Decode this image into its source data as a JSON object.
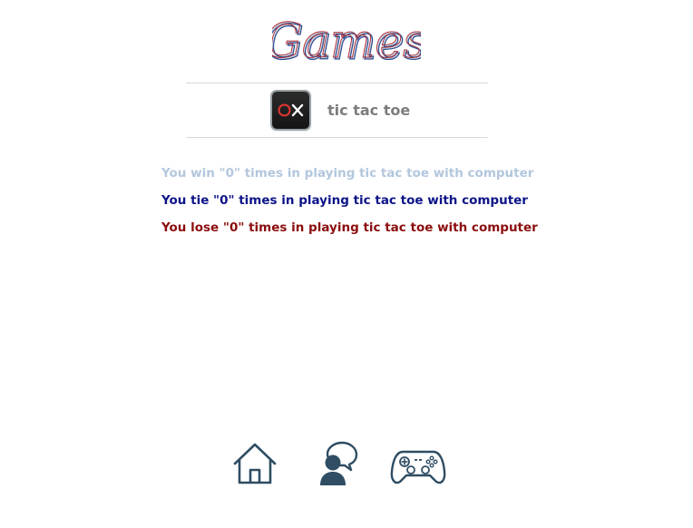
{
  "header": {
    "logo_text": "Games"
  },
  "game": {
    "title": "tic tac toe",
    "icon": "ox-icon"
  },
  "stats": {
    "win": "You win \"0\" times in playing tic tac toe with computer",
    "tie": "You tie \"0\" times in playing tic tac toe with computer",
    "lose": "You lose \"0\" times in playing tic tac toe with computer",
    "colors": {
      "win": "#b3c7dd",
      "tie": "#0d1488",
      "lose": "#8b0e0e"
    }
  },
  "nav": {
    "items": [
      {
        "icon": "home-icon"
      },
      {
        "icon": "user-chat-icon"
      },
      {
        "icon": "gamepad-icon"
      }
    ],
    "color": "#2f4d63"
  }
}
